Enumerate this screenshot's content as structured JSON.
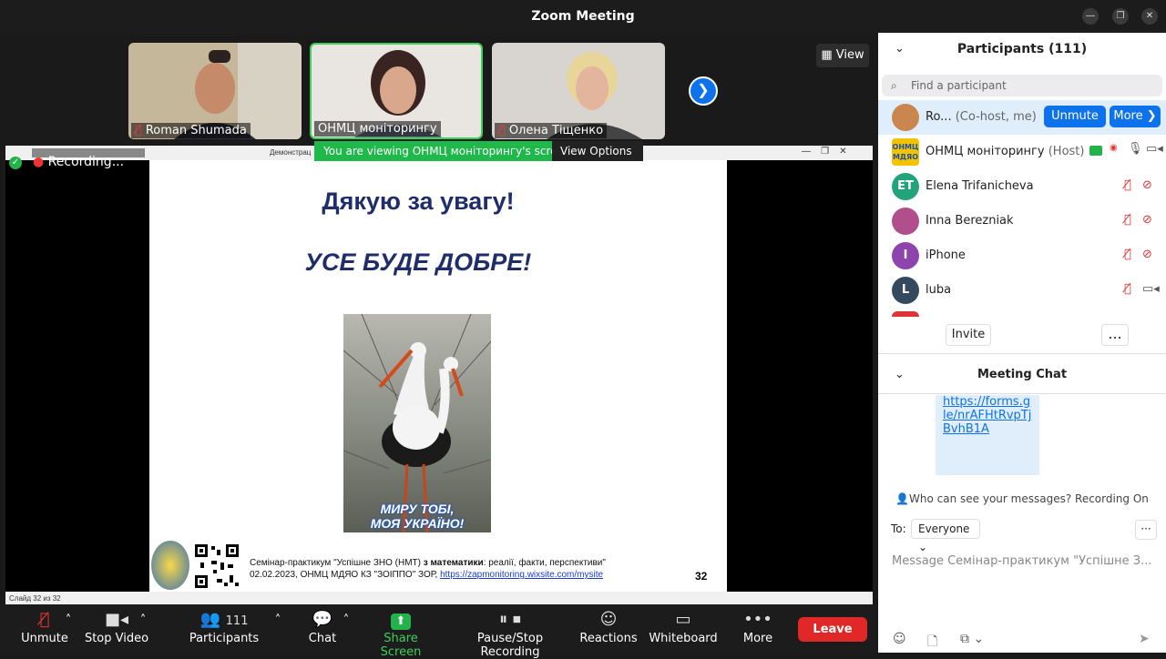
{
  "window": {
    "title": "Zoom Meeting"
  },
  "view_button": "View",
  "thumbnails": [
    {
      "name": "Roman Shumada",
      "muted": true
    },
    {
      "name": "ОНМЦ моніторингу",
      "muted": false
    },
    {
      "name": "Олена Тіщенко",
      "muted": true
    }
  ],
  "share_banner": {
    "text": "You are viewing ОНМЦ моніторингу's screen",
    "view_options": "View Options"
  },
  "recording": "Recording...",
  "ppt": {
    "titlebar": "Демонстрац",
    "status": "Слайд 32 из 32"
  },
  "slide": {
    "title": "Дякую за увагу!",
    "subtitle": "УСЕ БУДЕ ДОБРЕ!",
    "photo_caption_1": "МИРУ ТОБІ,",
    "photo_caption_2": "МОЯ УКРАЇНО!",
    "footer_line1_a": "Семінар-практикум \"Успішне ЗНО (НМТ) ",
    "footer_line1_b": "з математики",
    "footer_line1_c": ": реалії, факти, перспективи\"",
    "footer_line2": "02.02.2023, ОНМЦ МДЯО КЗ \"ЗОІППО\" ЗОР, ",
    "footer_link": "https://zapmonitoring.wixsite.com/mysite",
    "page_number": "32"
  },
  "toolbar": {
    "unmute": "Unmute",
    "stop_video": "Stop Video",
    "participants": "Participants",
    "participants_count": "111",
    "chat": "Chat",
    "share_screen": "Share Screen",
    "recording": "Pause/Stop Recording",
    "reactions": "Reactions",
    "whiteboard": "Whiteboard",
    "more": "More",
    "leave": "Leave"
  },
  "participants_panel": {
    "title": "Participants (111)",
    "search_placeholder": "Find a participant",
    "rows": [
      {
        "name": "Ro...",
        "role": "(Co-host, me)",
        "avatar": "",
        "color": "#c9874f"
      },
      {
        "name": "ОНМЦ моніторингу",
        "role": "(Host)",
        "avatar": "ОНМЦ МДЯО",
        "color": "#1f4fa3"
      },
      {
        "name": "Elena Trifanicheva",
        "role": "",
        "avatar": "ET",
        "color": "#23a37a"
      },
      {
        "name": "Inna Berezniak",
        "role": "",
        "avatar": "",
        "color": "#b14f8c"
      },
      {
        "name": "iPhone",
        "role": "",
        "avatar": "I",
        "color": "#8e44ad"
      },
      {
        "name": "luba",
        "role": "",
        "avatar": "L",
        "color": "#34495e"
      }
    ],
    "unmute_btn": "Unmute",
    "more_btn": "More",
    "invite": "Invite",
    "dots": "..."
  },
  "chat_panel": {
    "title": "Meeting Chat",
    "message_link": "https://forms.gle/nrAFHtRvpTjBvhB1A",
    "who_can_see": "Who can see your messages? Recording On",
    "to_label": "To:",
    "to_value": "Everyone",
    "input_placeholder": "Message Семінар-практикум \"Успішне З..."
  }
}
